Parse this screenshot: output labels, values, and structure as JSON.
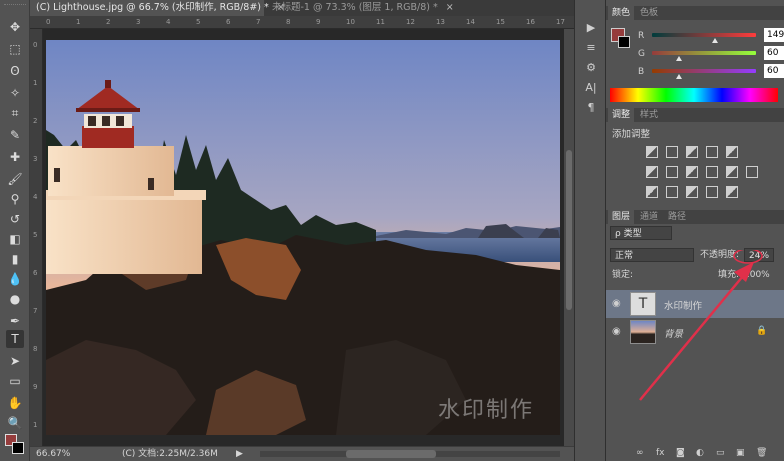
{
  "tabs": [
    {
      "label": "(C) Lighthouse.jpg @ 66.7% (水印制作, RGB/8#) *",
      "close": "×"
    },
    {
      "label": "未标题-1 @ 73.3% (图层 1, RGB/8) *",
      "close": "×"
    }
  ],
  "ruler_top_ticks": [
    "0",
    "1",
    "2",
    "3",
    "4",
    "5",
    "6",
    "7",
    "8",
    "9",
    "10",
    "11",
    "12",
    "13",
    "14",
    "15",
    "16",
    "17"
  ],
  "ruler_left_ticks": [
    "0",
    "1",
    "2",
    "3",
    "4",
    "5",
    "6",
    "7",
    "8",
    "9",
    "1"
  ],
  "watermark": "水印制作",
  "status": {
    "zoom": "66.67%",
    "doc": "(C) 文档:2.25M/2.36M",
    "arrow": "▶"
  },
  "color_panel": {
    "tabs": [
      "颜色",
      "色板"
    ],
    "channels": [
      {
        "label": "R",
        "value": "149",
        "level": 0.58
      },
      {
        "label": "G",
        "value": "60",
        "level": 0.24
      },
      {
        "label": "B",
        "value": "60",
        "level": 0.24
      }
    ],
    "foreground": "#953c3c",
    "background": "#000000"
  },
  "adjustments_panel": {
    "tabs": [
      "调整",
      "样式"
    ],
    "heading": "添加调整"
  },
  "layers_panel": {
    "tabs": [
      "图层",
      "通道",
      "路径"
    ],
    "filter_label": "ρ 类型",
    "blend_mode": "正常",
    "opacity_label": "不透明度:",
    "opacity_value": "24%",
    "lock_label": "锁定:",
    "fill_label": "填充:",
    "fill_value": "100%",
    "layers": [
      {
        "name": "水印制作",
        "type": "text",
        "selected": true,
        "thumb_glyph": "T"
      },
      {
        "name": "背景",
        "type": "image",
        "selected": false
      }
    ],
    "footer_icons": [
      "link-icon",
      "fx-icon",
      "mask-icon",
      "adjustment-icon",
      "folder-icon",
      "new-layer-icon",
      "trash-icon"
    ],
    "footer_glyphs": [
      "∞",
      "fx",
      "◙",
      "◐",
      "▭",
      "▣",
      "🗑"
    ]
  },
  "tools": [
    "move",
    "marquee",
    "lasso",
    "quick-select",
    "crop",
    "eyedropper",
    "healing",
    "brush",
    "clone-stamp",
    "history-brush",
    "eraser",
    "gradient",
    "blur",
    "dodge",
    "pen",
    "type",
    "path-select",
    "rectangle",
    "hand",
    "zoom"
  ],
  "tool_glyphs": [
    "✥",
    "⬚",
    "ʘ",
    "✧",
    "⌗",
    "✎",
    "✚",
    "🖌",
    "⚲",
    "↺",
    "◧",
    "▮",
    "💧",
    "●",
    "✒",
    "T",
    "➤",
    "▭",
    "✋",
    "🔍"
  ],
  "mid_icons": [
    "▶",
    "≡",
    "⚙",
    "A|",
    "¶"
  ]
}
